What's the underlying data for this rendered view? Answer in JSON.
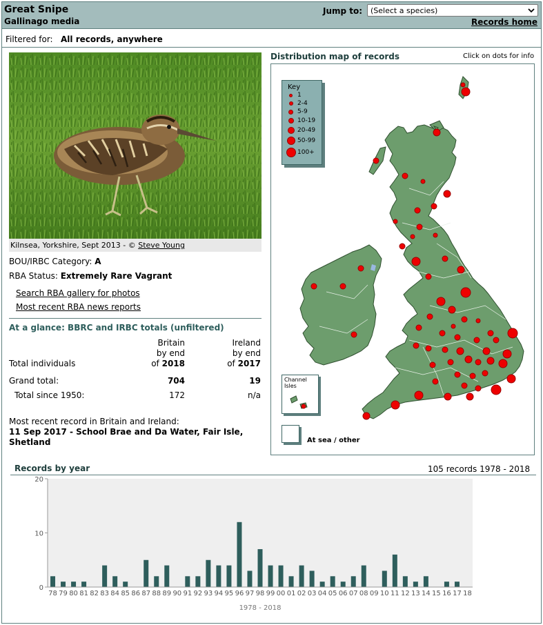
{
  "header": {
    "species_name": "Great Snipe",
    "media_title": "Gallinago media",
    "jump_label": "Jump to:",
    "species_select_value": "(Select a species)",
    "records_home": "Records home"
  },
  "filter": {
    "label": "Filtered for:",
    "value": "All records, anywhere"
  },
  "photo": {
    "caption_prefix": "Kilnsea, Yorkshire, Sept 2013 - © ",
    "caption_author": "Steve Young"
  },
  "status": {
    "category_label": "BOU/IRBC Category:",
    "category_value": "A",
    "rba_label": "RBA Status:",
    "rba_value": "Extremely Rare Vagrant",
    "gallery_link": "Search RBA gallery for photos",
    "news_link": "Most recent RBA news reports"
  },
  "glance": {
    "title": "At a glance: BBRC and IRBC totals (unfiltered)",
    "col_britain_line1": "Britain",
    "col_britain_line2": "by end",
    "col_britain_line3_prefix": "of ",
    "col_britain_year": "2018",
    "col_ireland_line1": "Ireland",
    "col_ireland_line2": "by end",
    "col_ireland_line3_prefix": "of ",
    "col_ireland_year": "2017",
    "row_total_individuals": "Total individuals",
    "row_grand_total": "Grand total:",
    "grand_total_britain": "704",
    "grand_total_ireland": "19",
    "row_since_1950": "Total since 1950:",
    "since_1950_britain": "172",
    "since_1950_ireland": "n/a"
  },
  "recent": {
    "label": "Most recent record in Britain and Ireland:",
    "value": "11 Sep 2017  - School Brae and Da Water, Fair Isle, Shetland"
  },
  "map": {
    "title": "Distribution map of records",
    "hint": "Click on dots for info",
    "key_title": "Key",
    "key_labels": [
      "1",
      "2-4",
      "5-9",
      "10-19",
      "20-49",
      "50-99",
      "100+"
    ],
    "channel_label_1": "Channel",
    "channel_label_2": "Isles",
    "sea_label": "At sea / other",
    "colors": {
      "land": "#6d9d6d",
      "land_border": "#2e4e2e",
      "dot": "#ee0000",
      "water": "#ffffff"
    }
  },
  "year_chart": {
    "title": "Records by year",
    "summary": "105 records 1978 - 2018"
  },
  "chart_data": {
    "type": "bar",
    "title": "Records by year",
    "xlabel": "1978 - 2018",
    "ylabel": "",
    "ylim": [
      0,
      20
    ],
    "yticks": [
      0,
      10,
      20
    ],
    "categories": [
      "78",
      "79",
      "80",
      "81",
      "82",
      "83",
      "84",
      "85",
      "86",
      "87",
      "88",
      "89",
      "90",
      "91",
      "92",
      "93",
      "94",
      "95",
      "96",
      "97",
      "98",
      "99",
      "00",
      "01",
      "02",
      "03",
      "04",
      "05",
      "06",
      "07",
      "08",
      "09",
      "10",
      "11",
      "12",
      "13",
      "14",
      "15",
      "16",
      "17",
      "18"
    ],
    "values": [
      2,
      1,
      1,
      1,
      0,
      4,
      2,
      1,
      0,
      5,
      2,
      4,
      0,
      2,
      2,
      5,
      4,
      4,
      12,
      3,
      7,
      4,
      4,
      2,
      4,
      3,
      1,
      2,
      1,
      2,
      4,
      0,
      3,
      6,
      2,
      1,
      2,
      0,
      1,
      1,
      0
    ],
    "bar_color": "#2e5e5c",
    "plot_bg": "#efefef"
  }
}
